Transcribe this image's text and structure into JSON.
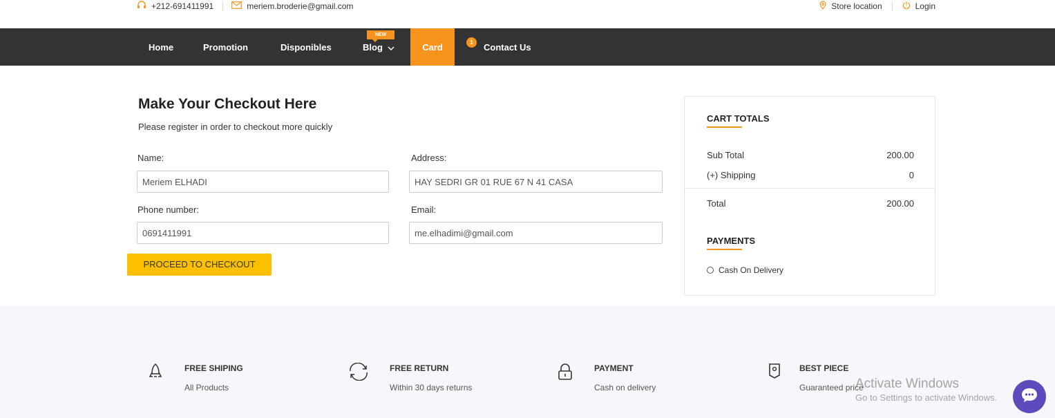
{
  "topbar": {
    "phone": "+212-691411991",
    "email": "meriem.broderie@gmail.com",
    "store_location": "Store location",
    "login": "Login"
  },
  "nav": {
    "items": [
      "Home",
      "Promotion",
      "Disponibles",
      "Blog",
      "Card",
      "Contact Us"
    ],
    "new_badge": "NEW",
    "contact_badge": "1",
    "active": "Card",
    "accent_color": "#f7941d"
  },
  "checkout": {
    "title": "Make Your Checkout Here",
    "subtitle": "Please register in order to checkout more quickly",
    "name_label": "Name:",
    "name_value": "Meriem ELHADI",
    "address_label": "Address:",
    "address_value": "HAY SEDRI GR 01 RUE 67 N 41 CASA",
    "phone_label": "Phone number:",
    "phone_value": "0691411991",
    "email_label": "Email:",
    "email_value": "me.elhadimi@gmail.com",
    "proceed_button": "PROCEED TO CHECKOUT"
  },
  "cart_totals": {
    "heading": "CART TOTALS",
    "subtotal_label": "Sub Total",
    "subtotal_value": "200.00",
    "shipping_label": "(+) Shipping",
    "shipping_value": "0",
    "total_label": "Total",
    "total_value": "200.00",
    "payments_heading": "PAYMENTS",
    "payment_option": "Cash On Delivery"
  },
  "features": [
    {
      "title": "FREE SHIPING",
      "subtitle": "All Products",
      "icon": "rocket-icon"
    },
    {
      "title": "FREE RETURN",
      "subtitle": "Within 30 days returns",
      "icon": "refresh-icon"
    },
    {
      "title": "PAYMENT",
      "subtitle": "Cash on delivery",
      "icon": "lock-icon"
    },
    {
      "title": "BEST PIECE",
      "subtitle": "Guaranteed price",
      "icon": "tag-icon"
    }
  ],
  "watermark": {
    "line1": "Activate Windows",
    "line2": "Go to Settings to activate Windows."
  }
}
